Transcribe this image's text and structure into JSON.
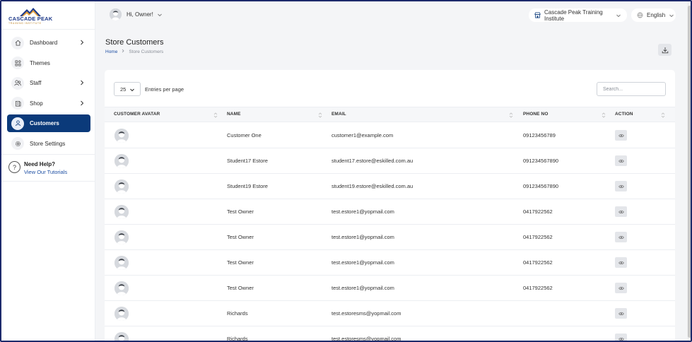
{
  "brand": {
    "name": "CASCADE PEAK",
    "tagline": "TRAINING INSTITUTE"
  },
  "topbar": {
    "greeting": "Hi, Owner!",
    "institute": "Cascade Peak Training Institute",
    "language": "English"
  },
  "sidebar": {
    "items": [
      {
        "label": "Dashboard",
        "icon": "home-icon",
        "has_chevron": true
      },
      {
        "label": "Themes",
        "icon": "grid-icon",
        "has_chevron": false
      },
      {
        "label": "Staff",
        "icon": "users-icon",
        "has_chevron": true
      },
      {
        "label": "Shop",
        "icon": "bag-icon",
        "has_chevron": true
      },
      {
        "label": "Customers",
        "icon": "user-icon",
        "has_chevron": false,
        "active": true
      },
      {
        "label": "Store Settings",
        "icon": "gear-icon",
        "has_chevron": false
      }
    ],
    "help_title": "Need Help?",
    "help_link": "View Our Tutorials"
  },
  "page": {
    "title": "Store Customers",
    "breadcrumb_home": "Home",
    "breadcrumb_current": "Store Customers"
  },
  "table": {
    "entries_value": "25",
    "entries_label": "Entries per page",
    "search_placeholder": "Search...",
    "columns": [
      "CUSTOMER AVATAR",
      "NAME",
      "EMAIL",
      "PHONE NO",
      "ACTION"
    ],
    "rows": [
      {
        "name": "Customer One",
        "email": "customer1@example.com",
        "phone": "09123456789"
      },
      {
        "name": "Student17 Estore",
        "email": "student17.estore@eskilled.com.au",
        "phone": "091234567890"
      },
      {
        "name": "Student19 Estore",
        "email": "student19.estore@eskilled.com.au",
        "phone": "091234567890"
      },
      {
        "name": "Test Owner",
        "email": "test.estore1@yopmail.com",
        "phone": "0417922562"
      },
      {
        "name": "Test Owner",
        "email": "test.estore1@yopmail.com",
        "phone": "0417922562"
      },
      {
        "name": "Test Owner",
        "email": "test.estore1@yopmail.com",
        "phone": "0417922562"
      },
      {
        "name": "Test Owner",
        "email": "test.estore1@yopmail.com",
        "phone": "0417922562"
      },
      {
        "name": "Richards",
        "email": "test.estoresms@yopmail.com",
        "phone": ""
      },
      {
        "name": "Richards",
        "email": "test.estoresms@yopmail.com",
        "phone": ""
      }
    ]
  },
  "colors": {
    "accent": "#0b3a7a",
    "link": "#1e4fa3",
    "frame": "#1d2a6b"
  }
}
